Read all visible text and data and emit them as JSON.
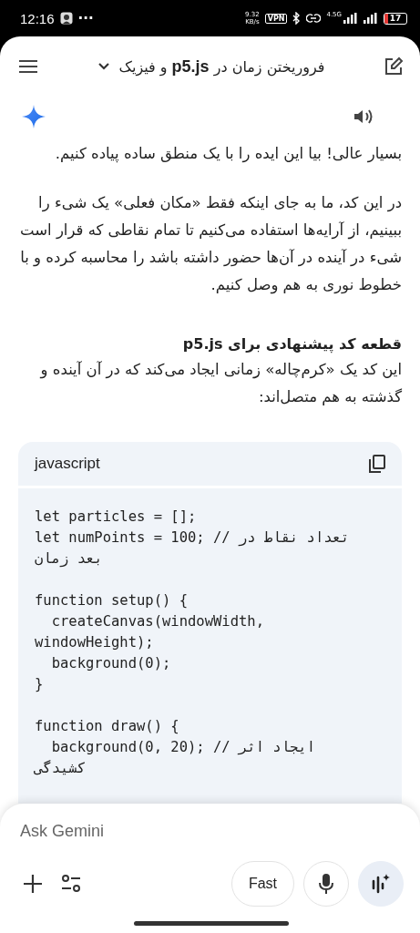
{
  "status_bar": {
    "time": "12:16",
    "overflow": "···",
    "net_speed": "9.32",
    "net_unit": "KB/s",
    "vpn": "VPN",
    "network_type": "4.5G",
    "battery": "17"
  },
  "header": {
    "title": "فروریختن زمان در **p5.js** و فیزیک"
  },
  "message": {
    "paragraphs": [
      "بسیار عالی! بیا این ایده را با یک منطق ساده پیاده کنیم.",
      "در این کد، ما به جای اینکه فقط «مکان فعلی» یک شیء را ببینیم، از آرایه‌ها استفاده می‌کنیم تا تمام نقاطی که قرار است شیء در آینده در آن‌ها حضور داشته باشد را محاسبه کرده و با خطوط نوری به هم وصل کنیم."
    ],
    "heading": "قطعه کد پیشنهادی برای p5.js",
    "intro": "این کد یک «کرم‌چاله» زمانی ایجاد می‌کند که در آن آینده و گذشته به هم متصل‌اند:",
    "code": {
      "language": "javascript",
      "blocks": [
        [
          "let particles = [];",
          "let numPoints = 100; // تعداد نقاط در بعد زمان"
        ],
        [
          "function setup() {",
          "  createCanvas(windowWidth, windowHeight);",
          "  background(0);",
          "}"
        ],
        [
          "function draw() {",
          "  background(0, 20); // ایجاد اثر کشیدگی"
        ]
      ]
    }
  },
  "composer": {
    "placeholder": "Ask Gemini",
    "mode_button": "Fast"
  }
}
